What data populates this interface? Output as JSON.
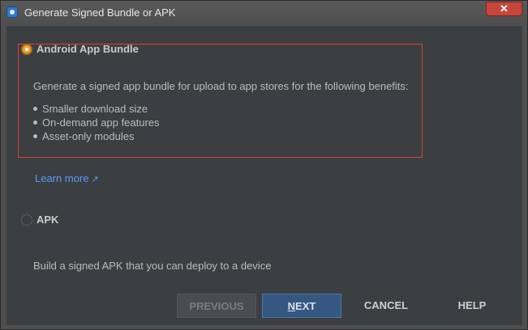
{
  "window": {
    "title": "Generate Signed Bundle or APK",
    "close_label": "✕"
  },
  "options": {
    "bundle": {
      "label": "Android App Bundle",
      "selected": true,
      "description": "Generate a signed app bundle for upload to app stores for the following benefits:",
      "benefits": [
        "Smaller download size",
        "On-demand app features",
        "Asset-only modules"
      ],
      "learn_more": "Learn more",
      "learn_more_icon": "↗"
    },
    "apk": {
      "label": "APK",
      "selected": false,
      "description": "Build a signed APK that you can deploy to a device"
    }
  },
  "buttons": {
    "previous": "PREVIOUS",
    "next_mnemonic": "N",
    "next_rest": "EXT",
    "cancel": "CANCEL",
    "help": "HELP"
  },
  "colors": {
    "background": "#3c3f41",
    "accent_radio": "#f2a23a",
    "link": "#589df6",
    "primary_button": "#365880",
    "focus_border": "#d8413c"
  }
}
